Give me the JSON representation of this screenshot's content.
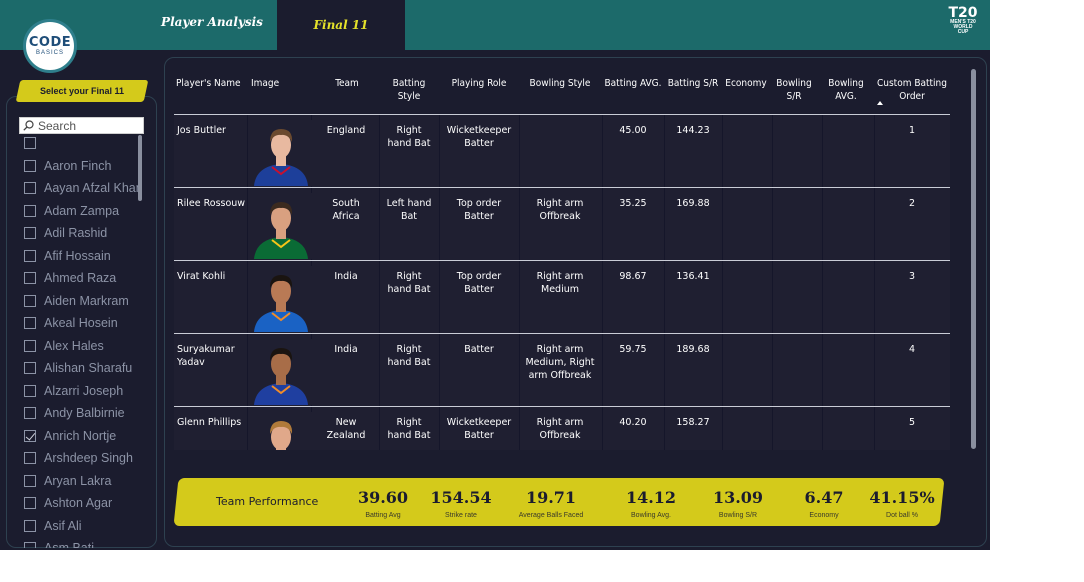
{
  "header": {
    "logo_main": "CODE",
    "logo_sub": "BASICS",
    "tabs": [
      "Player Analysis",
      "Final 11"
    ],
    "wc_logo_number": "T20",
    "wc_logo_text": "MEN'S T20 WORLD CUP"
  },
  "slicer": {
    "title": "Select your Final 11",
    "search_placeholder": "Search",
    "items": [
      {
        "label": "",
        "checked": false
      },
      {
        "label": "Aaron Finch",
        "checked": false
      },
      {
        "label": "Aayan Afzal Khan",
        "checked": false
      },
      {
        "label": "Adam Zampa",
        "checked": false
      },
      {
        "label": "Adil Rashid",
        "checked": false
      },
      {
        "label": "Afif Hossain",
        "checked": false
      },
      {
        "label": "Ahmed Raza",
        "checked": false
      },
      {
        "label": "Aiden Markram",
        "checked": false
      },
      {
        "label": "Akeal Hosein",
        "checked": false
      },
      {
        "label": "Alex Hales",
        "checked": false
      },
      {
        "label": "Alishan Sharafu",
        "checked": false
      },
      {
        "label": "Alzarri Joseph",
        "checked": false
      },
      {
        "label": "Andy Balbirnie",
        "checked": false
      },
      {
        "label": "Anrich Nortje",
        "checked": true
      },
      {
        "label": "Arshdeep Singh",
        "checked": false
      },
      {
        "label": "Aryan Lakra",
        "checked": false
      },
      {
        "label": "Ashton Agar",
        "checked": false
      },
      {
        "label": "Asif Ali",
        "checked": false
      },
      {
        "label": "Asm Bati...",
        "checked": false
      }
    ]
  },
  "table": {
    "headers": {
      "name": "Player's Name",
      "image": "Image",
      "team": "Team",
      "batting_style": "Batting Style",
      "playing_role": "Playing Role",
      "bowling_style": "Bowling Style",
      "batting_avg": "Batting AVG.",
      "batting_sr": "Batting S/R",
      "economy": "Economy",
      "bowling_sr": "Bowling S/R",
      "bowling_avg": "Bowling AVG.",
      "custom_order": "Custom Batting Order"
    },
    "rows": [
      {
        "name": "Jos Buttler",
        "team": "England",
        "batting_style": "Right hand Bat",
        "playing_role": "Wicketkeeper Batter",
        "bowling_style": "",
        "batting_avg": "45.00",
        "batting_sr": "144.23",
        "economy": "",
        "bowling_sr": "",
        "bowling_avg": "",
        "order": "1",
        "jersey": "#1d3f9a",
        "accent": "#c8102e",
        "skin": "#e8b9a0",
        "hair": "#6b4a2f"
      },
      {
        "name": "Rilee Rossouw",
        "team": "South Africa",
        "batting_style": "Left hand Bat",
        "playing_role": "Top order Batter",
        "bowling_style": "Right arm Offbreak",
        "batting_avg": "35.25",
        "batting_sr": "169.88",
        "economy": "",
        "bowling_sr": "",
        "bowling_avg": "",
        "order": "2",
        "jersey": "#0a6b35",
        "accent": "#f5c518",
        "skin": "#d9a080",
        "hair": "#3b2a1f"
      },
      {
        "name": "Virat Kohli",
        "team": "India",
        "batting_style": "Right hand Bat",
        "playing_role": "Top order Batter",
        "bowling_style": "Right arm Medium",
        "batting_avg": "98.67",
        "batting_sr": "136.41",
        "economy": "",
        "bowling_sr": "",
        "bowling_avg": "",
        "order": "3",
        "jersey": "#1a62c4",
        "accent": "#f28c28",
        "skin": "#b97a55",
        "hair": "#1a1410"
      },
      {
        "name": "Suryakumar Yadav",
        "team": "India",
        "batting_style": "Right hand Bat",
        "playing_role": "Batter",
        "bowling_style": "Right arm Medium, Right arm Offbreak",
        "batting_avg": "59.75",
        "batting_sr": "189.68",
        "economy": "",
        "bowling_sr": "",
        "bowling_avg": "",
        "order": "4",
        "jersey": "#1f3fa0",
        "accent": "#f28c28",
        "skin": "#a86d48",
        "hair": "#1a1410"
      },
      {
        "name": "Glenn Phillips",
        "team": "New Zealand",
        "batting_style": "Right hand Bat",
        "playing_role": "Wicketkeeper Batter",
        "bowling_style": "Right arm Offbreak",
        "batting_avg": "40.20",
        "batting_sr": "158.27",
        "economy": "",
        "bowling_sr": "",
        "bowling_avg": "",
        "order": "5",
        "jersey": "#1a1a1a",
        "accent": "#444444",
        "skin": "#e0a88a",
        "hair": "#b07a3a"
      }
    ]
  },
  "kpis": {
    "title": "Team Performance",
    "items": [
      {
        "value": "39.60",
        "label": "Batting Avg"
      },
      {
        "value": "154.54",
        "label": "Strike rate"
      },
      {
        "value": "19.71",
        "label": "Average Balls Faced"
      },
      {
        "value": "14.12",
        "label": "Bowling Avg."
      },
      {
        "value": "13.09",
        "label": "Bowling S/R"
      },
      {
        "value": "6.47",
        "label": "Economy"
      },
      {
        "value": "41.15%",
        "label": "Dot ball %"
      }
    ]
  },
  "colors": {
    "background": "#1b1c2e",
    "header": "#1c6a6a",
    "accent": "#d4ca1b",
    "active_tab_text": "#e5e22a"
  }
}
